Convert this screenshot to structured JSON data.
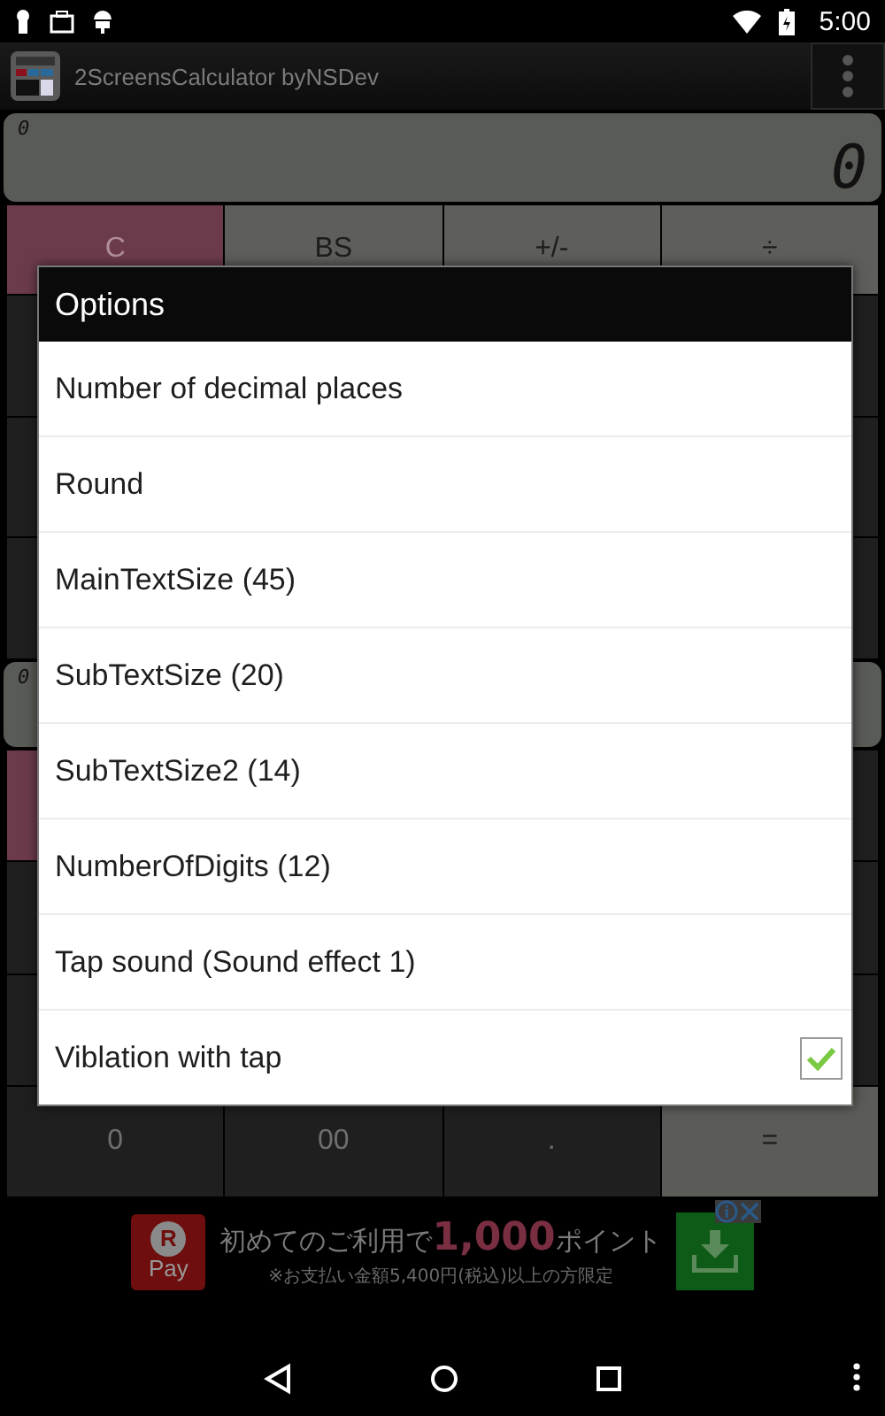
{
  "status_bar": {
    "time": "5:00"
  },
  "app_bar": {
    "title": "2ScreensCalculator byNSDev"
  },
  "calculator": {
    "display": {
      "sub": "0",
      "main": "0"
    },
    "top_keys": [
      {
        "label": "C",
        "kind": "clear"
      },
      {
        "label": "BS",
        "kind": "op"
      },
      {
        "label": "+/-",
        "kind": "op"
      },
      {
        "label": "÷",
        "kind": "op"
      }
    ],
    "display_2": {
      "sub": "0"
    },
    "bottom_keys": [
      {
        "label": "0",
        "kind": "digit"
      },
      {
        "label": "00",
        "kind": "digit"
      },
      {
        "label": ".",
        "kind": "digit"
      },
      {
        "label": "=",
        "kind": "equals"
      }
    ]
  },
  "dialog": {
    "title": "Options",
    "items": [
      {
        "label": "Number of decimal places",
        "kind": "text"
      },
      {
        "label": "Round",
        "kind": "text"
      },
      {
        "label": "MainTextSize (45)",
        "kind": "text"
      },
      {
        "label": "SubTextSize (20)",
        "kind": "text"
      },
      {
        "label": "SubTextSize2 (14)",
        "kind": "text"
      },
      {
        "label": "NumberOfDigits (12)",
        "kind": "text"
      },
      {
        "label": "Tap sound (Sound effect 1)",
        "kind": "text"
      },
      {
        "label": "Viblation with tap",
        "kind": "checkbox",
        "checked": true
      }
    ]
  },
  "ad": {
    "logo_letter": "R",
    "logo_text": "Pay",
    "headline_prefix": "初めてのご利用で",
    "headline_highlight": "1,000",
    "headline_suffix": "ポイント",
    "note": "※お支払い金額5,400円(税込)以上の方限定"
  }
}
